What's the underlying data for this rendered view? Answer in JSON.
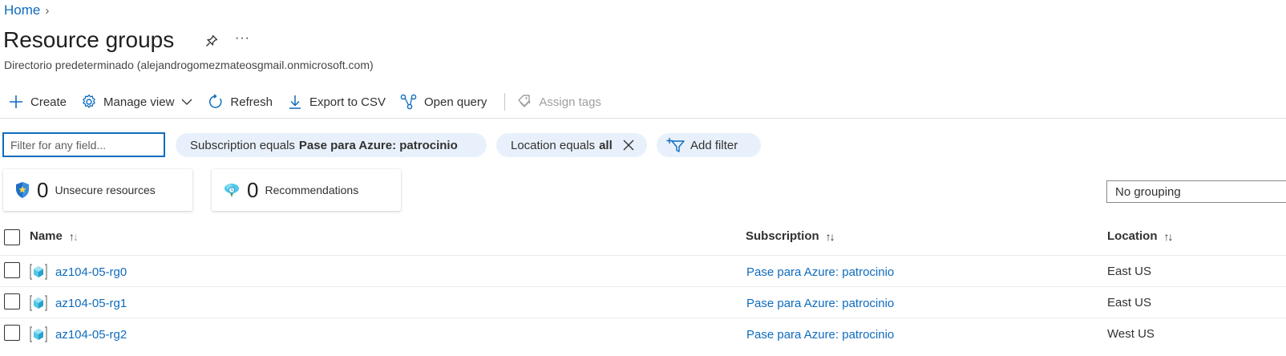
{
  "breadcrumb": {
    "home": "Home",
    "separator": "›"
  },
  "page": {
    "title": "Resource groups",
    "subtitle": "Directorio predeterminado (alejandrogomezmateosgmail.onmicrosoft.com)",
    "pin_icon": "pin-icon",
    "more_icon": "more-icon",
    "more_label": "···"
  },
  "toolbar": {
    "create": "Create",
    "manage_view": "Manage view",
    "refresh": "Refresh",
    "export_csv": "Export to CSV",
    "open_query": "Open query",
    "assign_tags": "Assign tags"
  },
  "filters": {
    "placeholder": "Filter for any field...",
    "subscription_prefix": "Subscription equals",
    "subscription_value": "Pase para Azure: patrocinio",
    "location_prefix": "Location equals",
    "location_value": "all",
    "add_filter": "Add filter"
  },
  "summary": {
    "unsecure_count": "0",
    "unsecure_label": "Unsecure resources",
    "recommendations_count": "0",
    "recommendations_label": "Recommendations"
  },
  "grouping": {
    "selected": "No grouping"
  },
  "table": {
    "columns": {
      "name": "Name",
      "subscription": "Subscription",
      "location": "Location"
    },
    "sort_glyph": "↑↓",
    "rows": [
      {
        "name": "az104-05-rg0",
        "subscription": "Pase para Azure: patrocinio",
        "location": "East US"
      },
      {
        "name": "az104-05-rg1",
        "subscription": "Pase para Azure: patrocinio",
        "location": "East US"
      },
      {
        "name": "az104-05-rg2",
        "subscription": "Pase para Azure: patrocinio",
        "location": "West US"
      }
    ]
  },
  "colors": {
    "accent": "#0f6cbd",
    "pill_bg": "#e8f1fb",
    "text": "#323130"
  }
}
